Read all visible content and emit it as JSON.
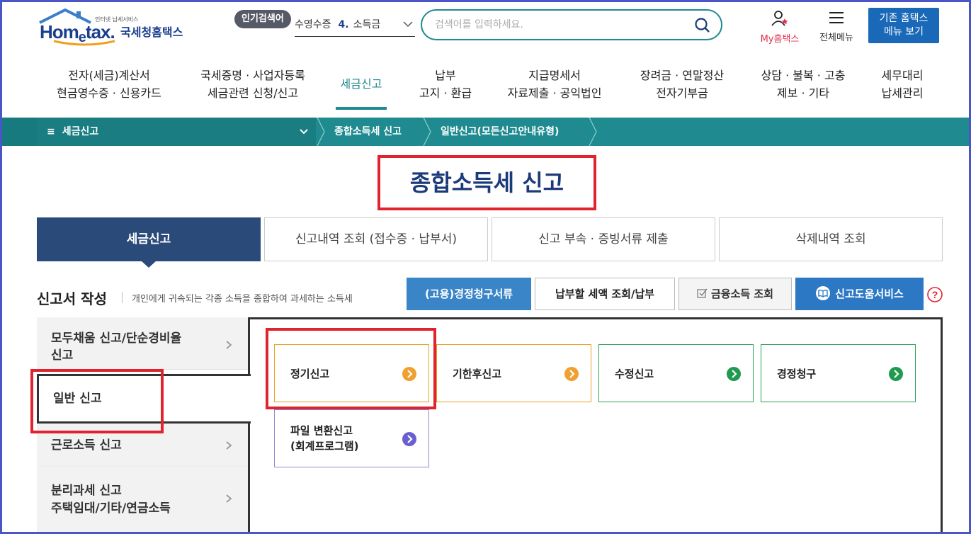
{
  "header": {
    "logo_sub": "인터넷 납세서비스",
    "logo_brand_pre": "Hom",
    "logo_brand_e": "e",
    "logo_brand_post": "tax.",
    "logo_kr": "국세청홈택스",
    "popular_label": "인기검색어",
    "popular_prefix": "수영수증",
    "popular_rank": "4.",
    "popular_term": "소득금",
    "search_placeholder": "검색어를 입력하세요.",
    "my_label": "My홈택스",
    "all_menu_label": "전체메뉴",
    "legacy_line1": "기존 홈택스",
    "legacy_line2": "메뉴 보기"
  },
  "gnb": [
    {
      "line1": "전자(세금)계산서",
      "line2": "현금영수증 · 신용카드"
    },
    {
      "line1": "국세증명 · 사업자등록",
      "line2": "세금관련 신청/신고"
    },
    {
      "line1": "세금신고",
      "line2": ""
    },
    {
      "line1": "납부",
      "line2": "고지 · 환급"
    },
    {
      "line1": "지급명세서",
      "line2": "자료제출 · 공익법인"
    },
    {
      "line1": "장려금 · 연말정산",
      "line2": "전자기부금"
    },
    {
      "line1": "상담 · 불복 · 고충",
      "line2": "제보 · 기타"
    },
    {
      "line1": "세무대리",
      "line2": "납세관리"
    }
  ],
  "breadcrumb": {
    "menu": "세금신고",
    "level2": "종합소득세 신고",
    "level3": "일반신고(모든신고안내유형)"
  },
  "page_title": "종합소득세 신고",
  "tabs": [
    "세금신고",
    "신고내역 조회 (접수증 · 납부서)",
    "신고 부속 · 증빙서류 제출",
    "삭제내역 조회"
  ],
  "section": {
    "title": "신고서 작성",
    "desc": "개인에게 귀속되는 각종 소득을 종합하여 과세하는 소득세"
  },
  "actions": {
    "claim_docs": "(고용)경정청구서류",
    "tax_due": "납부할 세액 조회/납부",
    "financial_income": "금융소득 조회",
    "help_service": "신고도움서비스"
  },
  "side_menu": [
    {
      "line1": "모두채움 신고/단순경비율",
      "line2": "신고"
    },
    {
      "line1": "일반 신고",
      "line2": ""
    },
    {
      "line1": "근로소득 신고",
      "line2": ""
    },
    {
      "line1": "분리과세 신고",
      "line2": "주택임대/기타/연금소득"
    }
  ],
  "cards": [
    {
      "line1": "정기신고",
      "line2": "",
      "color": "#f0a030"
    },
    {
      "line1": "기한후신고",
      "line2": "",
      "color": "#f0a030"
    },
    {
      "line1": "수정신고",
      "line2": "",
      "color": "#1f9a4e"
    },
    {
      "line1": "경정청구",
      "line2": "",
      "color": "#1f9a4e"
    },
    {
      "line1": "파일 변환신고",
      "line2": "(회계프로그램)",
      "color": "#6a5fcf"
    }
  ]
}
